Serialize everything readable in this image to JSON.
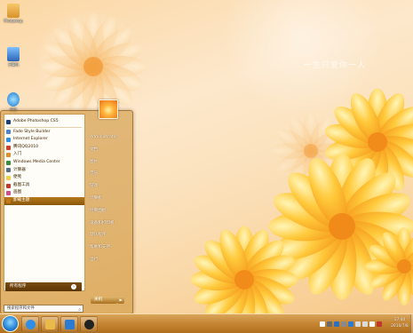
{
  "wallpaper": {
    "watermark": "一生只爱你一人"
  },
  "desktop_icons": [
    {
      "label": "Photoshop",
      "icon": "adobe-folder-icon",
      "color": "#e8a53c"
    },
    {
      "label": "计算机",
      "icon": "computer-icon",
      "color": "#3b7fd1"
    },
    {
      "label": "网络",
      "icon": "ie-icon",
      "color": "#2f8ee6"
    }
  ],
  "start_menu": {
    "pinned_programs": [
      {
        "label": "Adobe Photoshop CS5",
        "icon": "photoshop-icon",
        "color": "#1b3f78"
      }
    ],
    "recent_programs": [
      {
        "label": "Fade Style Builder",
        "icon": "style-builder-icon",
        "color": "#4a86c9"
      },
      {
        "label": "Internet Explorer",
        "icon": "ie-icon",
        "color": "#2f8ee6"
      },
      {
        "label": "腾讯QQ2010",
        "icon": "qq-icon",
        "color": "#d33b2b"
      },
      {
        "label": "入门",
        "icon": "getting-started-icon",
        "color": "#e38d2b"
      },
      {
        "label": "Windows Media Center",
        "icon": "media-center-icon",
        "color": "#3b8c3e"
      },
      {
        "label": "计算器",
        "icon": "calculator-icon",
        "color": "#5a6f86"
      },
      {
        "label": "便笺",
        "icon": "sticky-notes-icon",
        "color": "#f2d04a"
      },
      {
        "label": "截图工具",
        "icon": "snipping-tool-icon",
        "color": "#c2392a"
      },
      {
        "label": "画图",
        "icon": "paint-icon",
        "color": "#d04a8c"
      },
      {
        "label": "卸载主题",
        "icon": "uninstall-theme-icon",
        "color": "#c47a17"
      }
    ],
    "selected_index": 9,
    "all_programs_label": "所有程序",
    "search_placeholder": "搜索程序和文件",
    "right_links": [
      "Administrator",
      "文档",
      "图片",
      "音乐",
      "游戏",
      "计算机",
      "控制面板",
      "设备和打印机",
      "默认程序",
      "帮助和支持",
      "运行..."
    ],
    "shutdown_label": "关机"
  },
  "taskbar": {
    "pinned": [
      {
        "name": "ie-icon",
        "color": "#2f8ee6"
      },
      {
        "name": "explorer-icon",
        "color": "#e9b94a"
      },
      {
        "name": "media-player-icon",
        "color": "#2c7bd3"
      },
      {
        "name": "qq-icon",
        "color": "#222222"
      }
    ],
    "tray": [
      {
        "name": "language-icon",
        "color": "#ffffff"
      },
      {
        "name": "keyboard-icon",
        "color": "#6b6b6b"
      },
      {
        "name": "help-icon",
        "color": "#2d6fc0"
      },
      {
        "name": "tray-settings-icon",
        "color": "#8a8a8a"
      },
      {
        "name": "ime-icon",
        "color": "#2e7ad0"
      },
      {
        "name": "network-icon",
        "color": "#dadada"
      },
      {
        "name": "volume-icon",
        "color": "#dadada"
      },
      {
        "name": "flag-icon",
        "color": "#ffffff"
      },
      {
        "name": "tray-app-icon",
        "color": "#c0392b"
      }
    ],
    "clock_time": "17:40",
    "clock_date": "2010/7/8"
  }
}
